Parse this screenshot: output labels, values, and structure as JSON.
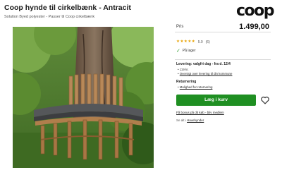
{
  "header": {
    "title": "Coop hynde til cirkelbænk - Antracit",
    "subtitle": "Solution Byed polyester - Passer til Coop cirkelbænk",
    "logo": "coop"
  },
  "price": {
    "label": "Pris",
    "value": "1.499,00"
  },
  "rating": {
    "stars_filled": 5,
    "stars_total": 5,
    "value": "5.0",
    "count": "(6)",
    "star_color": "#e8a200"
  },
  "stock": {
    "label": "På lager",
    "icon": "check-icon",
    "color": "#2d9a2d"
  },
  "delivery": {
    "title": "Levering: valgfri dag - fra d. 12/4",
    "items": [
      "119 kr.",
      "Oversigt over levering til din kommune"
    ]
  },
  "returns": {
    "title": "Returnering",
    "link": "Mulighed for returnering"
  },
  "cart": {
    "button_label": "Læg i kurv",
    "color": "#1f8f22",
    "favorite_icon": "heart-icon"
  },
  "bonus_text": "Få bonus på dit køb - bliv medlem",
  "see_all": {
    "prefix": "Se alt i",
    "link": "Havehynder"
  }
}
